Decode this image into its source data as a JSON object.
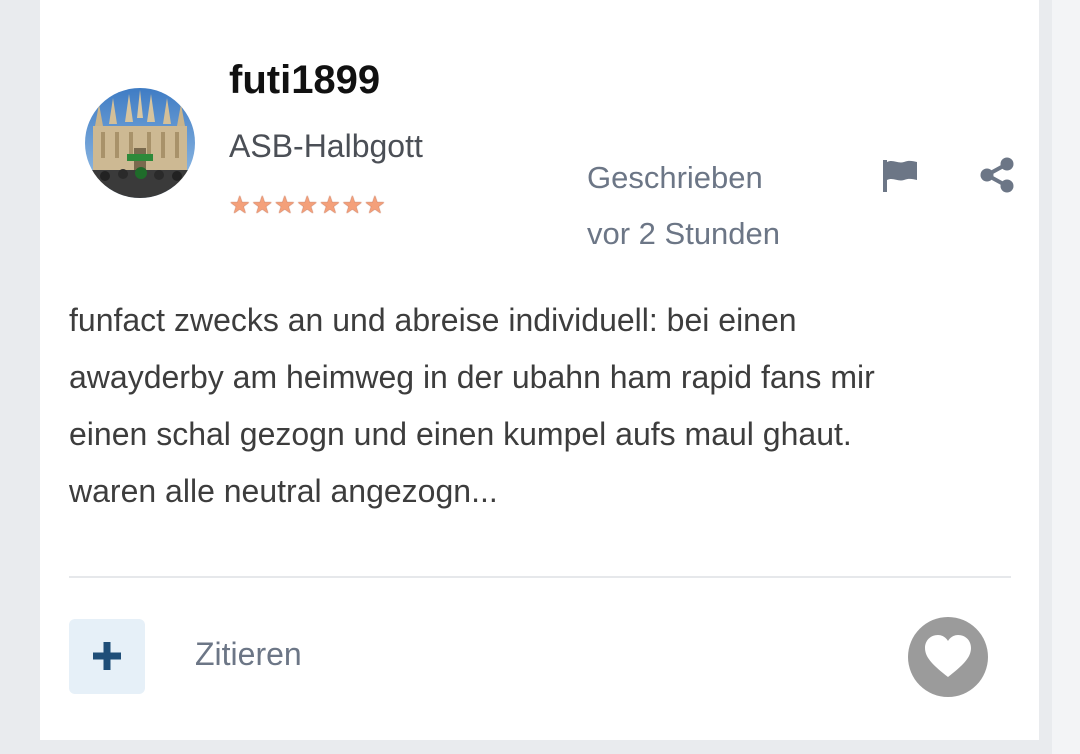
{
  "post": {
    "author": {
      "name": "futi1899",
      "rank": "ASB-Halbgott",
      "stars": "★★★★★★★",
      "avatar_icon": "avatar-cathedral-photo"
    },
    "meta": {
      "written_label": "Geschrieben",
      "time_ago": "vor 2 Stunden"
    },
    "actions": {
      "report_icon": "flag-icon",
      "share_icon": "share-icon"
    },
    "body_lines": [
      "funfact zwecks an und abreise individuell: bei einen",
      "awayderby am heimweg in der ubahn ham rapid fans mir",
      "einen schal gezogn und einen kumpel aufs maul ghaut.",
      "waren alle neutral angezogn..."
    ],
    "footer": {
      "multiquote_icon": "plus-icon",
      "quote_label": "Zitieren",
      "reaction_icon": "heart-icon"
    }
  },
  "colors": {
    "page_bg": "#e9ebee",
    "card_bg": "#ffffff",
    "meta_text": "#6c7686",
    "body_text": "#3d3d3d",
    "accent": "#1f4e78",
    "like_bg": "#9b9b9b"
  }
}
